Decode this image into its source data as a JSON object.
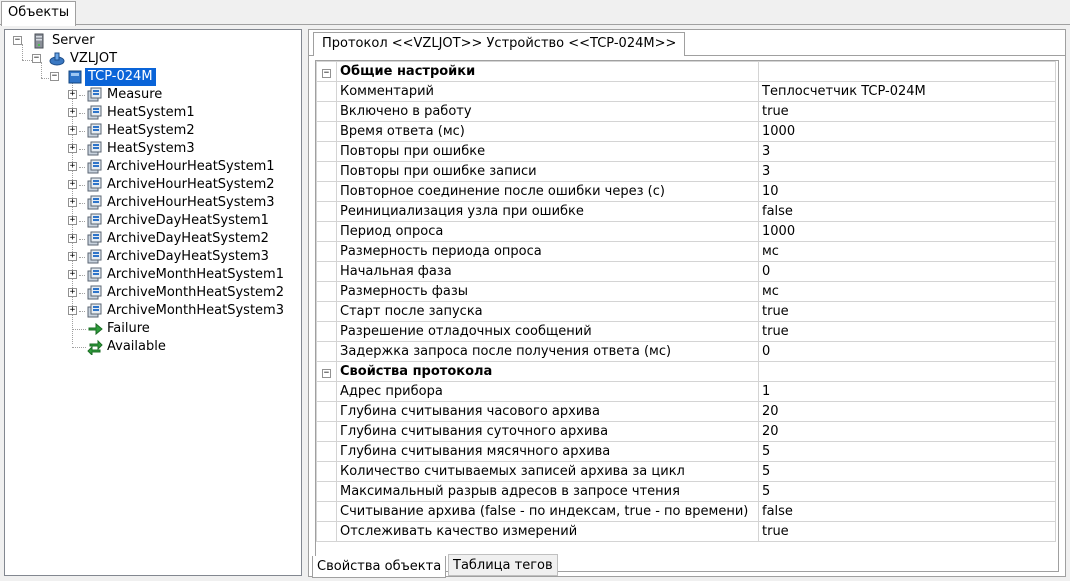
{
  "top_tab": "Объекты",
  "tree": {
    "server": "Server",
    "vzljot": "VZLJOT",
    "device": "TCP-024M",
    "children": [
      "Measure",
      "HeatSystem1",
      "HeatSystem2",
      "HeatSystem3",
      "ArchiveHourHeatSystem1",
      "ArchiveHourHeatSystem2",
      "ArchiveHourHeatSystem3",
      "ArchiveDayHeatSystem1",
      "ArchiveDayHeatSystem2",
      "ArchiveDayHeatSystem3",
      "ArchiveMonthHeatSystem1",
      "ArchiveMonthHeatSystem2",
      "ArchiveMonthHeatSystem3"
    ],
    "failure": "Failure",
    "available": "Available"
  },
  "panel_tab": "Протокол <<VZLJOT>> Устройство <<TCP-024M>>",
  "grid": {
    "general_header": "Общие настройки",
    "general": [
      {
        "name": "Комментарий",
        "value": "Теплосчетчик TCP-024M"
      },
      {
        "name": "Включено в работу",
        "value": "true"
      },
      {
        "name": "Время ответа (мс)",
        "value": "1000"
      },
      {
        "name": "Повторы при ошибке",
        "value": "3"
      },
      {
        "name": "Повторы при ошибке записи",
        "value": "3"
      },
      {
        "name": "Повторное соединение после ошибки через (с)",
        "value": "10"
      },
      {
        "name": "Реинициализация узла при ошибке",
        "value": "false"
      },
      {
        "name": "Период опроса",
        "value": "1000"
      },
      {
        "name": "Размерность периода опроса",
        "value": "мс"
      },
      {
        "name": "Начальная фаза",
        "value": "0"
      },
      {
        "name": "Размерность фазы",
        "value": "мс"
      },
      {
        "name": "Старт после запуска",
        "value": "true"
      },
      {
        "name": "Разрешение отладочных сообщений",
        "value": "true"
      },
      {
        "name": "Задержка запроса после получения ответа (мс)",
        "value": "0"
      }
    ],
    "protocol_header": "Свойства протокола",
    "protocol": [
      {
        "name": "Адрес прибора",
        "value": "1"
      },
      {
        "name": "Глубина считывания часового архива",
        "value": "20"
      },
      {
        "name": "Глубина считывания суточного архива",
        "value": "20"
      },
      {
        "name": "Глубина считывания мясячного архива",
        "value": "5"
      },
      {
        "name": "Количество считываемых записей архива за цикл",
        "value": "5"
      },
      {
        "name": "Максимальный разрыв адресов в запросе чтения",
        "value": "5"
      },
      {
        "name": "Считывание архива (false - по индексам, true - по времени)",
        "value": "false"
      },
      {
        "name": "Отслеживать качество измерений",
        "value": "true"
      }
    ]
  },
  "bottom_tabs": {
    "properties": "Свойства объекта",
    "tags": "Таблица тегов"
  },
  "icons": {
    "server": "server-icon",
    "protocol": "network-protocol-icon",
    "device": "device-icon",
    "group": "tag-group-icon",
    "failure": "arrow-right-icon",
    "available": "exchange-arrows-icon"
  }
}
